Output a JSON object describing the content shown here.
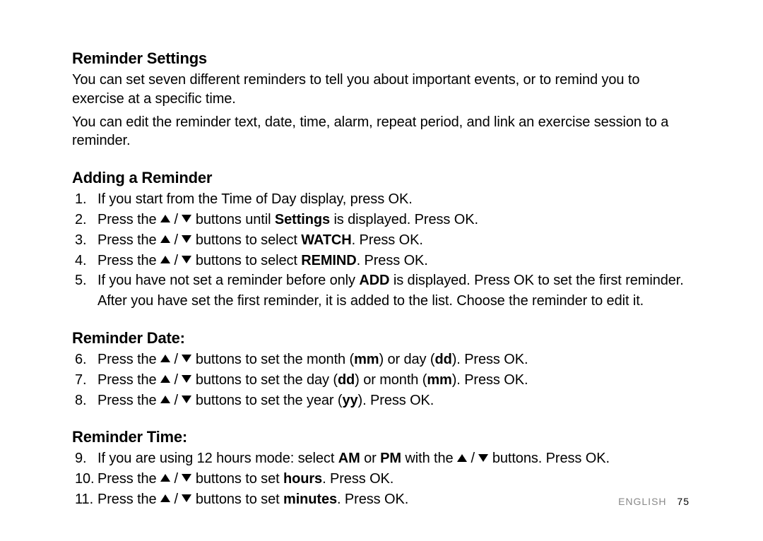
{
  "sections": {
    "reminder_settings": {
      "heading": "Reminder Settings",
      "para1": "You can set seven different reminders to tell you about important events, or to remind you to exercise at a specific time.",
      "para2": "You can edit the reminder text, date, time, alarm, repeat period, and link an exercise session to a reminder."
    },
    "adding": {
      "heading": "Adding a Reminder",
      "items": {
        "i1": "If you start from the Time of Day display, press OK.",
        "i2_a": "Press the ",
        "i2_b": " buttons until ",
        "i2_bold": "Settings",
        "i2_c": " is displayed. Press OK.",
        "i3_a": "Press the ",
        "i3_b": " buttons to select ",
        "i3_bold": "WATCH",
        "i3_c": ". Press OK.",
        "i4_a": "Press the ",
        "i4_b": " buttons to select ",
        "i4_bold": "REMIND",
        "i4_c": ". Press OK.",
        "i5_a": "If you have not set a reminder before only ",
        "i5_bold": "ADD",
        "i5_b": " is displayed. Press OK to set the first reminder.",
        "i5_sub": "After you have set the first reminder, it is added to the list. Choose the reminder to edit it."
      }
    },
    "date": {
      "heading": "Reminder Date:",
      "items": {
        "i6_a": "Press the ",
        "i6_b": " buttons to set the month (",
        "i6_bold1": "mm",
        "i6_c": ") or day (",
        "i6_bold2": "dd",
        "i6_d": "). Press OK.",
        "i7_a": "Press the ",
        "i7_b": " buttons to set the day (",
        "i7_bold1": "dd",
        "i7_c": ") or month (",
        "i7_bold2": "mm",
        "i7_d": "). Press OK.",
        "i8_a": "Press the ",
        "i8_b": " buttons to set the year (",
        "i8_bold": "yy",
        "i8_c": "). Press OK."
      }
    },
    "time": {
      "heading": "Reminder Time:",
      "items": {
        "i9_a": "If you are using 12 hours mode: select ",
        "i9_bold1": "AM",
        "i9_b": " or ",
        "i9_bold2": "PM",
        "i9_c": " with the ",
        "i9_d": " buttons. Press OK.",
        "i10_a": "Press the ",
        "i10_b": " buttons to set ",
        "i10_bold": "hours",
        "i10_c": ". Press OK.",
        "i11_a": "Press the ",
        "i11_b": " buttons to set ",
        "i11_bold": "minutes",
        "i11_c": ". Press OK."
      }
    }
  },
  "footer": {
    "language": "ENGLISH",
    "page": "75"
  }
}
